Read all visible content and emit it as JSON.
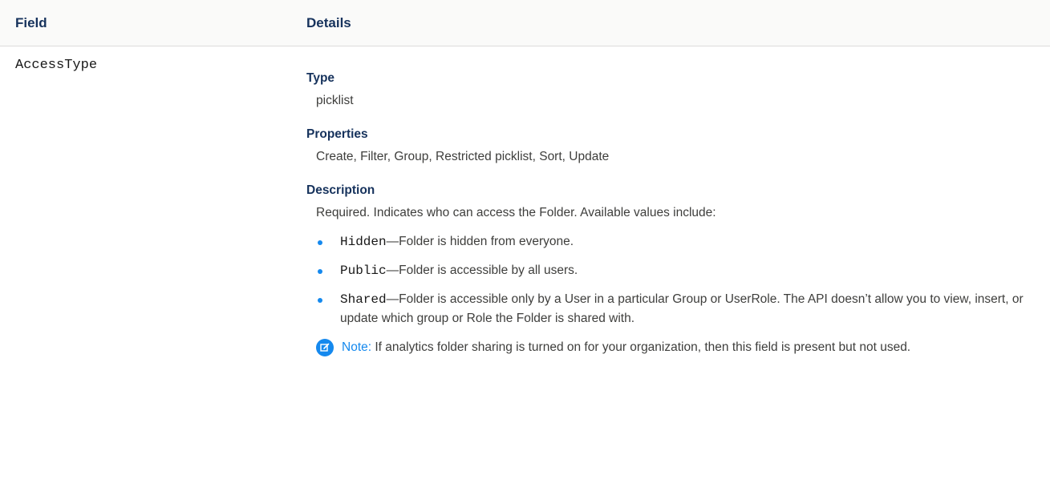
{
  "table": {
    "headers": {
      "field": "Field",
      "details": "Details"
    },
    "row": {
      "field_name": "AccessType",
      "type_label": "Type",
      "type_value": "picklist",
      "properties_label": "Properties",
      "properties_value": "Create, Filter, Group, Restricted picklist, Sort, Update",
      "description_label": "Description",
      "description_text": "Required. Indicates who can access the Folder. Available values include:",
      "values": [
        {
          "code": "Hidden",
          "text": "—Folder is hidden from everyone."
        },
        {
          "code": "Public",
          "text": "—Folder is accessible by all users."
        },
        {
          "code": "Shared",
          "text": "—Folder is accessible only by a User in a particular Group or UserRole. The API doesn’t allow you to view, insert, or update which group or Role the Folder is shared with."
        }
      ],
      "note_label": "Note:",
      "note_text": "If analytics folder sharing is turned on for your organization, then this field is present but not used."
    }
  },
  "colors": {
    "header_text": "#16325c",
    "accent": "#1589ee",
    "body_text": "#3e3e3c"
  },
  "icons": {
    "note": "note-edit-icon"
  }
}
